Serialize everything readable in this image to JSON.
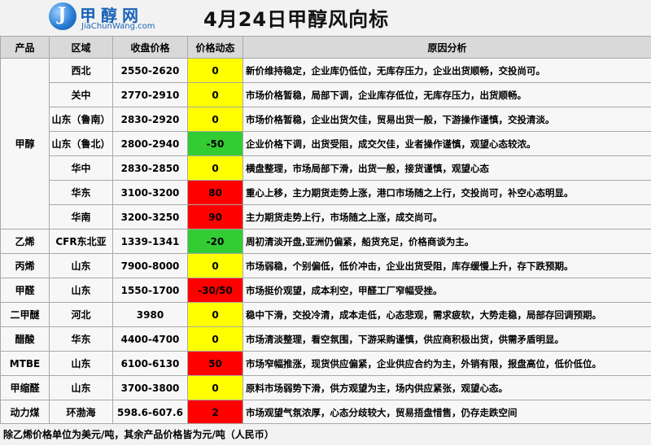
{
  "header": {
    "logo_cn": "甲醇网",
    "logo_en": "JiaChunWang.com",
    "title": "4月24日甲醇风向标"
  },
  "columns": [
    "产品",
    "区域",
    "收盘价格",
    "价格动态",
    "原因分析"
  ],
  "rows": [
    {
      "product": "甲醇",
      "region": "西北",
      "price": "2550-2620",
      "change": "0",
      "color": "yellow",
      "reason": "新价维持稳定，企业库仍低位，无库存压力，企业出货顺畅，交投尚可。"
    },
    {
      "product": "",
      "region": "关中",
      "price": "2770-2910",
      "change": "0",
      "color": "yellow",
      "reason": "市场价格暂稳，局部下调，企业库存低位，无库存压力，出货顺畅。"
    },
    {
      "product": "",
      "region": "山东（鲁南）",
      "price": "2830-2920",
      "change": "0",
      "color": "yellow",
      "reason": "市场价格暂稳，企业出货欠佳，贸易出货一般，下游操作谨慎，交投清淡。"
    },
    {
      "product": "",
      "region": "山东（鲁北）",
      "price": "2800-2940",
      "change": "-50",
      "color": "green",
      "reason": "企业价格下调，出货受阻，成交欠佳，业者操作谨慎，观望心态较浓。"
    },
    {
      "product": "",
      "region": "华中",
      "price": "2830-2850",
      "change": "0",
      "color": "yellow",
      "reason": "横盘整理，市场局部下滑，出货一般，接货谨慎，观望心态"
    },
    {
      "product": "",
      "region": "华东",
      "price": "3100-3200",
      "change": "80",
      "color": "red",
      "reason": "重心上移，主力期货走势上涨，港口市场随之上行，交投尚可，补空心态明显。"
    },
    {
      "product": "",
      "region": "华南",
      "price": "3200-3250",
      "change": "90",
      "color": "red",
      "reason": "主力期货走势上行，市场随之上涨，成交尚可。"
    },
    {
      "product": "乙烯",
      "region": "CFR东北亚",
      "price": "1339-1341",
      "change": "-20",
      "color": "green",
      "reason": "周初清淡开盘,亚洲仍偏紧，船货充足，价格商谈为主。"
    },
    {
      "product": "丙烯",
      "region": "山东",
      "price": "7900-8000",
      "change": "0",
      "color": "yellow",
      "reason": "市场弱稳，个别偏低，低价冲击，企业出货受阻，库存缓慢上升，存下跌预期。"
    },
    {
      "product": "甲醛",
      "region": "山东",
      "price": "1550-1700",
      "change": "-30/50",
      "color": "red",
      "reason": "市场挺价观望，成本利空，甲醛工厂窄幅受挫。"
    },
    {
      "product": "二甲醚",
      "region": "河北",
      "price": "3980",
      "change": "0",
      "color": "yellow",
      "reason": "稳中下滑，交投冷清，成本走低，心态悲观，需求疲软，大势走稳，局部存回调预期。"
    },
    {
      "product": "醋酸",
      "region": "华东",
      "price": "4400-4700",
      "change": "0",
      "color": "yellow",
      "reason": "市场清淡整理，看空氛围，下游采购谨慎，供应商积极出货，供需矛盾明显。"
    },
    {
      "product": "MTBE",
      "region": "山东",
      "price": "6100-6130",
      "change": "50",
      "color": "red",
      "reason": "市场窄幅推涨，现货供应偏紧，企业供应合约为主，外销有限，报盘高位，低价低位。"
    },
    {
      "product": "甲缩醛",
      "region": "山东",
      "price": "3700-3800",
      "change": "0",
      "color": "yellow",
      "reason": "原料市场弱势下滑，供方观望为主，场内供应紧张，观望心态。"
    },
    {
      "product": "动力煤",
      "region": "环渤海",
      "price": "598.6-607.6",
      "change": "2",
      "color": "red",
      "reason": "市场观望气氛浓厚，心态分歧较大，贸易捂盘惜售，仍存走跌空间"
    }
  ],
  "footer": "除乙烯价格单位为美元/吨，其余产品价格皆为元/吨（人民币）",
  "colors": {
    "yellow": "#ffff00",
    "red": "#ff0000",
    "green": "#33cc33"
  }
}
